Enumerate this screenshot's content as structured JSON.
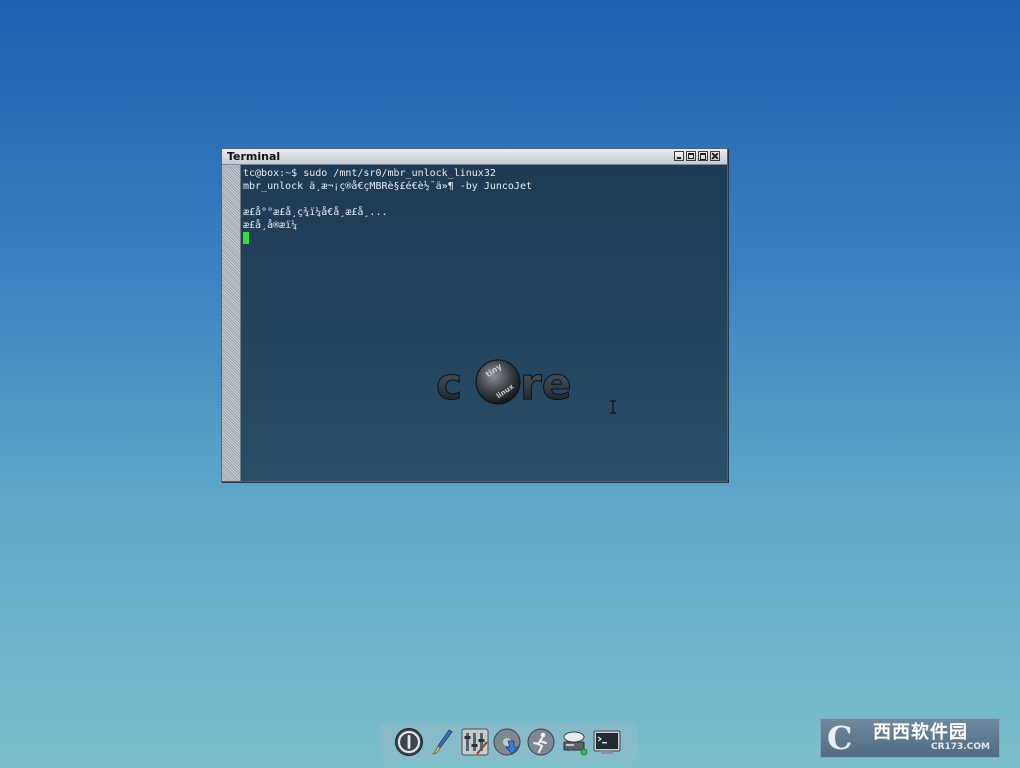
{
  "terminal": {
    "title": "Terminal",
    "lines": [
      "tc@box:~$ sudo /mnt/sr0/mbr_unlock_linux32",
      "mbr_unlock ä¸­æ¬¡ç®å€çMBRè§£é€è½¯ä»¶ -by JuncoJet",
      "",
      "æ­£å°°æ£å¸ç¾ï¼å€å¸æ£å¸...",
      "æ£å¸å®æï¼"
    ]
  },
  "wallpaper": {
    "logo_text": "core",
    "logo_badge_top": "tiny",
    "logo_badge_bottom": "linux"
  },
  "dock": {
    "items": [
      {
        "icon": "power-icon"
      },
      {
        "icon": "paintbrush-icon"
      },
      {
        "icon": "control-panel-icon"
      },
      {
        "icon": "apps-install-icon"
      },
      {
        "icon": "run-icon"
      },
      {
        "icon": "mount-tool-icon"
      },
      {
        "icon": "terminal-icon"
      }
    ]
  },
  "watermark": {
    "mark": "C",
    "name_cn": "西西软件园",
    "url": "CR173.COM"
  },
  "colors": {
    "terminal_bg": "#23445f",
    "terminal_text": "#e6ecf2",
    "cursor": "#33dd44"
  }
}
